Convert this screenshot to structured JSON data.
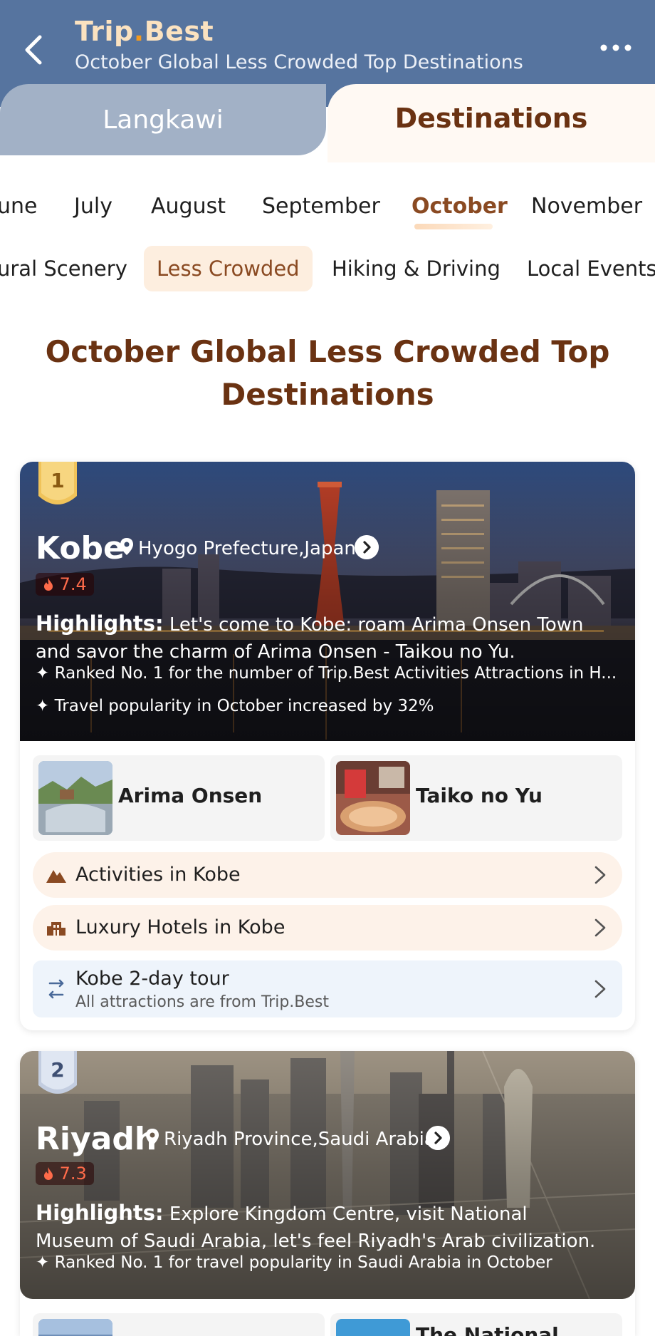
{
  "header": {
    "brand_main": "Trip",
    "brand_dot": ".",
    "brand_suffix": "Best",
    "subtitle": "October Global Less Crowded Top Destinations"
  },
  "tabs": [
    {
      "label": "Langkawi",
      "active": false
    },
    {
      "label": "Destinations",
      "active": true
    }
  ],
  "months": [
    "une",
    "July",
    "August",
    "September",
    "October",
    "November"
  ],
  "active_month": "October",
  "categories": [
    "ural Scenery",
    "Less Crowded",
    "Hiking & Driving",
    "Local Events"
  ],
  "active_category": "Less Crowded",
  "page_title": "October Global Less Crowded Top Destinations",
  "cards": [
    {
      "rank": "1",
      "city": "Kobe",
      "location": "Hyogo Prefecture,Japan",
      "score": "7.4",
      "highlights_label": "Highlights:",
      "highlights_text": "Let's come to Kobe: roam Arima Onsen Town and savor the charm of Arima Onsen - Taikou no Yu.",
      "facts": [
        "Ranked No. 1 for the number of Trip.Best Activities Attractions in H...",
        "Travel popularity in October increased by 32%"
      ],
      "pois": [
        "Arima Onsen",
        "Taiko no Yu"
      ],
      "links": [
        {
          "label": "Activities in Kobe",
          "icon": "mountain-icon"
        },
        {
          "label": "Luxury Hotels in Kobe",
          "icon": "hotel-icon"
        }
      ],
      "tour": {
        "title": "Kobe 2-day tour",
        "subtitle": "All attractions are from Trip.Best",
        "icon": "route-icon"
      }
    },
    {
      "rank": "2",
      "city": "Riyadh",
      "location": "Riyadh Province,Saudi Arabia",
      "score": "7.3",
      "highlights_label": "Highlights:",
      "highlights_text": "Explore Kingdom Centre, visit National Museum of Saudi Arabia, let's feel Riyadh's Arab civilization.",
      "facts": [
        "Ranked No. 1 for travel popularity in Saudi Arabia in October"
      ],
      "next_poi_partial": "The National"
    }
  ],
  "colors": {
    "header_bg": "#56749f",
    "brand": "#fbe2c0",
    "accent_brown": "#6a3212",
    "active_chip_bg": "#fdeedf",
    "score_red": "#ff6b4a"
  }
}
